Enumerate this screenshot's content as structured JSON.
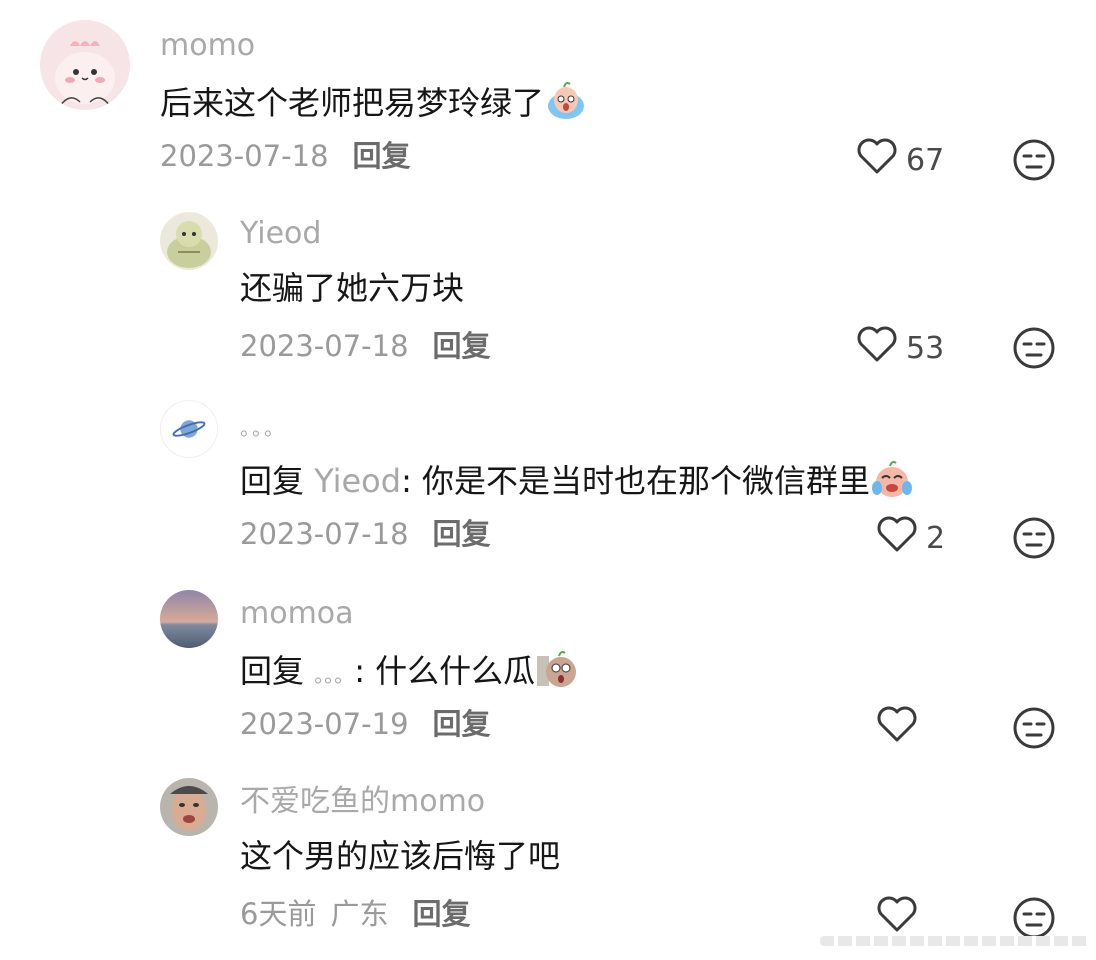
{
  "comments": [
    {
      "username": "momo",
      "content": "后来这个老师把易梦玲绿了",
      "date": "2023-07-18",
      "reply_label": "回复",
      "likes": "67"
    },
    {
      "username": "Yieod",
      "content": "还骗了她六万块",
      "date": "2023-07-18",
      "reply_label": "回复",
      "likes": "53"
    },
    {
      "username": "。。。",
      "content_prefix": "回复 ",
      "mention": "Yieod",
      "content": ": 你是不是当时也在那个微信群里",
      "date": "2023-07-18",
      "reply_label": "回复",
      "likes": "2"
    },
    {
      "username": "momoa",
      "content_prefix": "回复 ",
      "mention": "。。。",
      "content": ": 什么什么瓜",
      "date": "2023-07-19",
      "reply_label": "回复",
      "likes": ""
    },
    {
      "username": "不爱吃鱼的momo",
      "content": "这个男的应该后悔了吧",
      "date": "6天前",
      "location": "广东",
      "reply_label": "回复",
      "likes": ""
    }
  ],
  "icons": {
    "like": "heart-outline-icon",
    "dislike": "neutral-face-icon"
  }
}
